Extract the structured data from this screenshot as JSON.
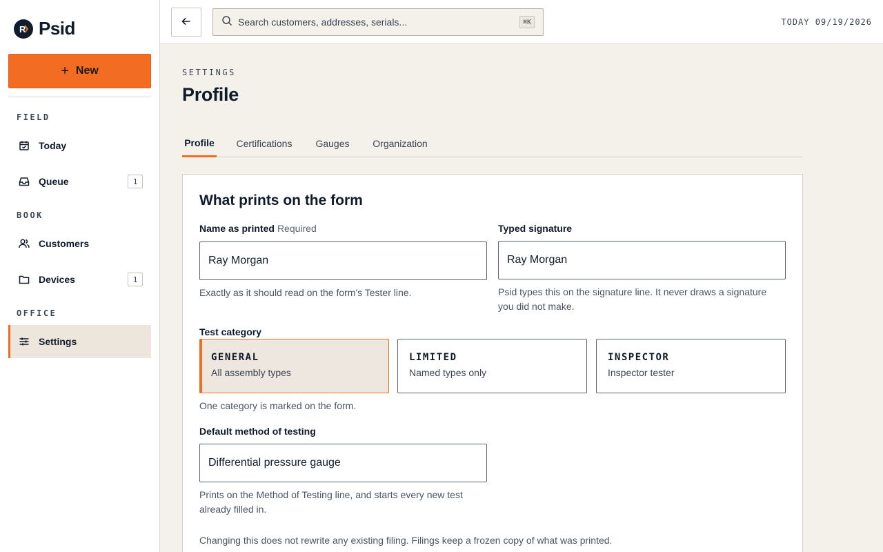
{
  "app": {
    "name": "Psid"
  },
  "sidebar": {
    "new_label": "New",
    "sections": [
      {
        "label": "FIELD"
      },
      {
        "label": "BOOK"
      },
      {
        "label": "OFFICE"
      }
    ],
    "items": [
      {
        "label": "Today",
        "icon": "calendar-check-icon"
      },
      {
        "label": "Queue",
        "icon": "inbox-icon",
        "count": "1"
      },
      {
        "label": "Customers",
        "icon": "users-icon"
      },
      {
        "label": "Devices",
        "icon": "folder-icon",
        "count": "1"
      },
      {
        "label": "Settings",
        "icon": "sliders-icon",
        "active": true
      }
    ]
  },
  "topbar": {
    "search_placeholder": "Search customers, addresses, serials...",
    "search_shortcut": "⌘K",
    "today": "TODAY 09/19/2026"
  },
  "page": {
    "eyebrow": "SETTINGS",
    "title": "Profile",
    "tabs": [
      {
        "label": "Profile",
        "active": true
      },
      {
        "label": "Certifications"
      },
      {
        "label": "Gauges"
      },
      {
        "label": "Organization"
      }
    ]
  },
  "form": {
    "title": "What prints on the form",
    "name_label": "Name as printed",
    "name_required": "Required",
    "name_value": "Ray Morgan",
    "name_help": "Exactly as it should read on the form's Tester line.",
    "signature_label": "Typed signature",
    "signature_value": "Ray Morgan",
    "signature_help_1": "Psid types this on the signature line. It never draws a signature",
    "signature_help_2": "you did not make.",
    "category_label": "Test category",
    "categories": [
      {
        "name": "GENERAL",
        "desc": "All assembly types",
        "selected": true
      },
      {
        "name": "LIMITED",
        "desc": "Named types only"
      },
      {
        "name": "INSPECTOR",
        "desc": "Inspector tester"
      }
    ],
    "category_help": "One category is marked on the form.",
    "method_label": "Default method of testing",
    "method_value": "Differential pressure gauge",
    "method_help_1": "Prints on the Method of Testing line, and starts every new test",
    "method_help_2": "already filled in.",
    "footer_note": "Changing this does not rewrite any existing filing. Filings keep a frozen copy of what was printed."
  },
  "colors": {
    "accent": "#f26d21",
    "navy": "#0f1e2e",
    "page_bg": "#f4f1ea"
  }
}
